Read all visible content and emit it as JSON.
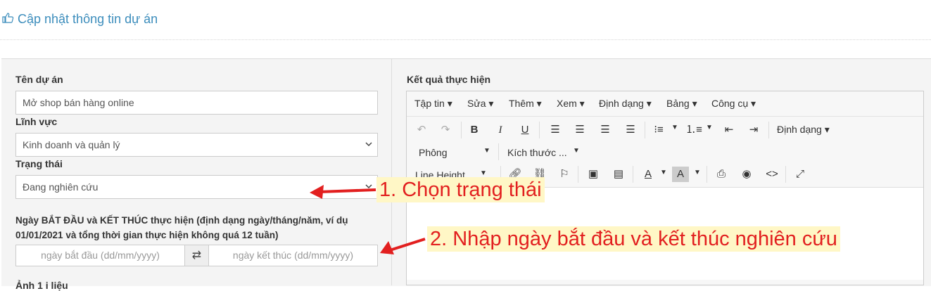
{
  "header": {
    "title": "Cập nhật thông tin dự án",
    "icon": "thumbs-up-icon"
  },
  "form": {
    "name_label": "Tên dự án",
    "name_value": "Mở shop bán hàng online",
    "field_label": "Lĩnh vực",
    "field_value": "Kinh doanh và quản lý",
    "status_label": "Trạng thái",
    "status_value": "Đang nghiên cứu",
    "dates_label": "Ngày BẮT ĐẦU và KẾT THÚC thực hiện (định dạng ngày/tháng/năm, ví dụ 01/01/2021 và tổng thời gian thực hiện không quá 12 tuần)",
    "start_placeholder": "ngày bắt đầu (dd/mm/yyyy)",
    "end_placeholder": "ngày kết thúc (dd/mm/yyyy)",
    "next_label_partial": "Ảnh 1 i liệu"
  },
  "editor": {
    "label": "Kết quả thực hiện",
    "menu": [
      "Tập tin",
      "Sửa",
      "Thêm",
      "Xem",
      "Định dạng",
      "Bảng",
      "Công cụ"
    ],
    "format_dropdown": "Định dạng",
    "font_dropdown": "Phông",
    "size_dropdown": "Kích thước ...",
    "line_height_dropdown": "Line Height",
    "bold": "B",
    "italic": "I",
    "underline": "U"
  },
  "annotations": {
    "step1": "1. Chọn trạng thái",
    "step2": "2. Nhập ngày bắt đầu và kết thúc nghiên cứu",
    "color": "#e21f1f"
  }
}
